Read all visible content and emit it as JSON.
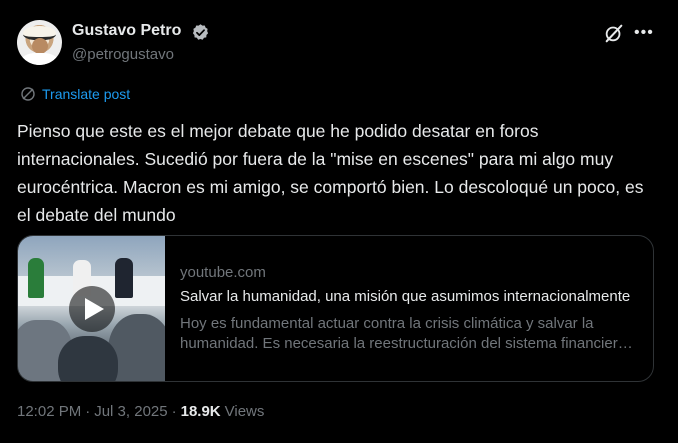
{
  "author": {
    "name": "Gustavo Petro",
    "handle": "@petrogustavo",
    "verified_icon": "verified-badge-icon"
  },
  "actions": {
    "grok_icon": "grok-icon",
    "more_icon": "more-icon",
    "more_glyph": "•••"
  },
  "translate": {
    "label": "Translate post",
    "icon": "globe-icon"
  },
  "tweet": {
    "text": "Pienso que este es el mejor debate que he podido desatar en foros internacionales. Sucedió por fuera de la \"mise en escenes\" para mi algo muy eurocéntrica. Macron es mi amigo, se comportó bien. Lo descoloqué un poco, es el debate del mundo"
  },
  "card": {
    "domain": "youtube.com",
    "title": "Salvar la humanidad, una misión que asumimos internacionalmente",
    "description": "Hoy es fundamental actuar contra la crisis climática y salvar la humanidad. Es necesaria la reestructuración del sistema financiero internacional",
    "play_icon": "play-icon"
  },
  "meta": {
    "time": "12:02 PM",
    "separator": "·",
    "date": "Jul 3, 2025",
    "views_count": "18.9K",
    "views_label": "Views"
  },
  "colors": {
    "background": "#000000",
    "text": "#e7e9ea",
    "muted": "#71767b",
    "accent": "#1d9bf0",
    "border": "#2f3336"
  }
}
